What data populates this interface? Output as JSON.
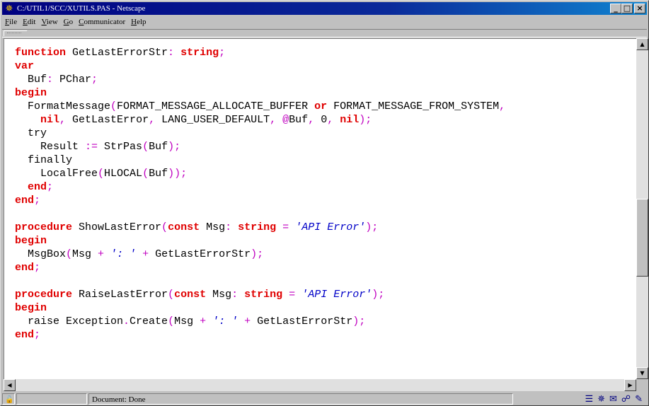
{
  "window": {
    "title": "C:/UTIL1/SCC/XUTILS.PAS - Netscape",
    "buttons": [
      "_",
      "□",
      "×"
    ]
  },
  "menu": [
    {
      "label": "File",
      "ul": "F",
      "rest": "ile"
    },
    {
      "label": "Edit",
      "ul": "E",
      "rest": "dit"
    },
    {
      "label": "View",
      "ul": "V",
      "rest": "iew"
    },
    {
      "label": "Go",
      "ul": "G",
      "rest": "o"
    },
    {
      "label": "Communicator",
      "ul": "C",
      "rest": "ommunicator"
    },
    {
      "label": "Help",
      "ul": "H",
      "rest": "elp"
    }
  ],
  "code_lines": [
    [
      [
        "kw",
        "function"
      ],
      [
        "t",
        " GetLastErrorStr"
      ],
      [
        "sym",
        ":"
      ],
      [
        "t",
        " "
      ],
      [
        "kw",
        "string"
      ],
      [
        "sym",
        ";"
      ]
    ],
    [
      [
        "kw",
        "var"
      ]
    ],
    [
      [
        "t",
        "  Buf"
      ],
      [
        "sym",
        ":"
      ],
      [
        "t",
        " PChar"
      ],
      [
        "sym",
        ";"
      ]
    ],
    [
      [
        "kw",
        "begin"
      ]
    ],
    [
      [
        "t",
        "  FormatMessage"
      ],
      [
        "sym",
        "("
      ],
      [
        "t",
        "FORMAT_MESSAGE_ALLOCATE_BUFFER "
      ],
      [
        "kw",
        "or"
      ],
      [
        "t",
        " FORMAT_MESSAGE_FROM_SYSTEM"
      ],
      [
        "sym",
        ","
      ]
    ],
    [
      [
        "t",
        "    "
      ],
      [
        "kw",
        "nil"
      ],
      [
        "sym",
        ","
      ],
      [
        "t",
        " GetLastError"
      ],
      [
        "sym",
        ","
      ],
      [
        "t",
        " LANG_USER_DEFAULT"
      ],
      [
        "sym",
        ","
      ],
      [
        "t",
        " "
      ],
      [
        "sym",
        "@"
      ],
      [
        "t",
        "Buf"
      ],
      [
        "sym",
        ","
      ],
      [
        "t",
        " 0"
      ],
      [
        "sym",
        ","
      ],
      [
        "t",
        " "
      ],
      [
        "kw",
        "nil"
      ],
      [
        "sym",
        ");"
      ]
    ],
    [
      [
        "t",
        "  try"
      ]
    ],
    [
      [
        "t",
        "    Result "
      ],
      [
        "sym",
        ":="
      ],
      [
        "t",
        " StrPas"
      ],
      [
        "sym",
        "("
      ],
      [
        "t",
        "Buf"
      ],
      [
        "sym",
        ");"
      ]
    ],
    [
      [
        "t",
        "  finally"
      ]
    ],
    [
      [
        "t",
        "    LocalFree"
      ],
      [
        "sym",
        "("
      ],
      [
        "t",
        "HLOCAL"
      ],
      [
        "sym",
        "("
      ],
      [
        "t",
        "Buf"
      ],
      [
        "sym",
        "));"
      ]
    ],
    [
      [
        "t",
        "  "
      ],
      [
        "kw",
        "end"
      ],
      [
        "sym",
        ";"
      ]
    ],
    [
      [
        "kw",
        "end"
      ],
      [
        "sym",
        ";"
      ]
    ],
    [],
    [
      [
        "kw",
        "procedure"
      ],
      [
        "t",
        " ShowLastError"
      ],
      [
        "sym",
        "("
      ],
      [
        "kw",
        "const"
      ],
      [
        "t",
        " Msg"
      ],
      [
        "sym",
        ":"
      ],
      [
        "t",
        " "
      ],
      [
        "kw",
        "string"
      ],
      [
        "t",
        " "
      ],
      [
        "sym",
        "="
      ],
      [
        "t",
        " "
      ],
      [
        "str",
        "'API Error'"
      ],
      [
        "sym",
        ");"
      ]
    ],
    [
      [
        "kw",
        "begin"
      ]
    ],
    [
      [
        "t",
        "  MsgBox"
      ],
      [
        "sym",
        "("
      ],
      [
        "t",
        "Msg "
      ],
      [
        "sym",
        "+"
      ],
      [
        "t",
        " "
      ],
      [
        "str",
        "': '"
      ],
      [
        "t",
        " "
      ],
      [
        "sym",
        "+"
      ],
      [
        "t",
        " GetLastErrorStr"
      ],
      [
        "sym",
        ");"
      ]
    ],
    [
      [
        "kw",
        "end"
      ],
      [
        "sym",
        ";"
      ]
    ],
    [],
    [
      [
        "kw",
        "procedure"
      ],
      [
        "t",
        " RaiseLastError"
      ],
      [
        "sym",
        "("
      ],
      [
        "kw",
        "const"
      ],
      [
        "t",
        " Msg"
      ],
      [
        "sym",
        ":"
      ],
      [
        "t",
        " "
      ],
      [
        "kw",
        "string"
      ],
      [
        "t",
        " "
      ],
      [
        "sym",
        "="
      ],
      [
        "t",
        " "
      ],
      [
        "str",
        "'API Error'"
      ],
      [
        "sym",
        ");"
      ]
    ],
    [
      [
        "kw",
        "begin"
      ]
    ],
    [
      [
        "t",
        "  raise Exception"
      ],
      [
        "sym",
        "."
      ],
      [
        "t",
        "Create"
      ],
      [
        "sym",
        "("
      ],
      [
        "t",
        "Msg "
      ],
      [
        "sym",
        "+"
      ],
      [
        "t",
        " "
      ],
      [
        "str",
        "': '"
      ],
      [
        "t",
        " "
      ],
      [
        "sym",
        "+"
      ],
      [
        "t",
        " GetLastErrorStr"
      ],
      [
        "sym",
        ");"
      ]
    ],
    [
      [
        "kw",
        "end"
      ],
      [
        "sym",
        ";"
      ]
    ]
  ],
  "scrollbars": {
    "vertical_up": "▲",
    "vertical_down": "▼",
    "horizontal_left": "◀",
    "horizontal_right": "▶",
    "vertical_position": 0.62
  },
  "status": {
    "text": "Document: Done",
    "icons": [
      "component-bar-icon",
      "netscape-icon",
      "mail-icon",
      "discussion-icon",
      "composer-icon"
    ]
  }
}
